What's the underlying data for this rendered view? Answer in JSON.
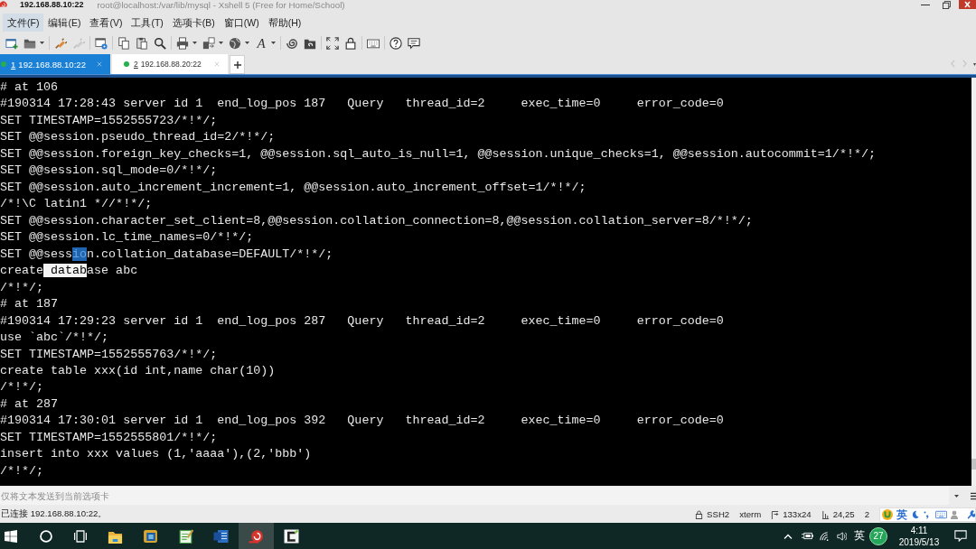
{
  "window": {
    "host": "192.168.88.10:22",
    "title": "root@localhost:/var/lib/mysql - Xshell 5 (Free for Home/School)"
  },
  "menu": [
    {
      "label": "文件(F)",
      "selected": true
    },
    {
      "label": "编辑(E)",
      "selected": false
    },
    {
      "label": "查看(V)",
      "selected": false
    },
    {
      "label": "工具(T)",
      "selected": false
    },
    {
      "label": "选项卡(B)",
      "selected": false
    },
    {
      "label": "窗口(W)",
      "selected": false
    },
    {
      "label": "帮助(H)",
      "selected": false
    }
  ],
  "toolbar": {
    "groups": [
      {
        "buttons": [
          {
            "kind": "new",
            "disabled": false,
            "dropdown": false
          },
          {
            "kind": "open",
            "disabled": false,
            "dropdown": true
          }
        ]
      },
      {
        "buttons": [
          {
            "kind": "plug",
            "disabled": false,
            "dropdown": false
          },
          {
            "kind": "plug",
            "disabled": true,
            "dropdown": false
          }
        ]
      },
      {
        "buttons": [
          {
            "kind": "properties",
            "disabled": false,
            "dropdown": false
          }
        ]
      },
      {
        "buttons": [
          {
            "kind": "copy",
            "disabled": false,
            "dropdown": false
          },
          {
            "kind": "paste",
            "disabled": false,
            "dropdown": false
          },
          {
            "kind": "find",
            "disabled": false,
            "dropdown": false
          }
        ]
      },
      {
        "buttons": [
          {
            "kind": "print",
            "disabled": false,
            "dropdown": true
          },
          {
            "kind": "transfer",
            "disabled": false,
            "dropdown": true
          },
          {
            "kind": "globe",
            "disabled": false,
            "dropdown": true
          },
          {
            "kind": "font",
            "glyph": "A",
            "disabled": false,
            "dropdown": true
          }
        ]
      },
      {
        "buttons": [
          {
            "kind": "spiral",
            "disabled": false,
            "dropdown": false
          },
          {
            "kind": "spiral-folder",
            "disabled": false,
            "dropdown": false
          }
        ]
      },
      {
        "buttons": [
          {
            "kind": "fullscreen",
            "disabled": false,
            "dropdown": false
          },
          {
            "kind": "lock",
            "disabled": false,
            "dropdown": false
          }
        ]
      },
      {
        "buttons": [
          {
            "kind": "keyboard",
            "disabled": false,
            "dropdown": false
          }
        ]
      },
      {
        "buttons": [
          {
            "kind": "help",
            "disabled": false,
            "dropdown": false
          },
          {
            "kind": "chat",
            "disabled": false,
            "dropdown": false
          }
        ]
      }
    ]
  },
  "tabs": [
    {
      "number": "1",
      "label": "192.168.88.10:22",
      "selected": true,
      "connected": true
    },
    {
      "number": "2",
      "label": "192.168.88.20:22",
      "selected": false,
      "connected": true
    }
  ],
  "terminal": {
    "lines": [
      {
        "text": "# at 106"
      },
      {
        "text": "#190314 17:28:43 server id 1  end_log_pos 187   Query   thread_id=2     exec_time=0     error_code=0"
      },
      {
        "text": "SET TIMESTAMP=1552555723/*!*/;"
      },
      {
        "text": "SET @@session.pseudo_thread_id=2/*!*/;"
      },
      {
        "text": "SET @@session.foreign_key_checks=1, @@session.sql_auto_is_null=1, @@session.unique_checks=1, @@session.autocommit=1/*!*/;"
      },
      {
        "text": "SET @@session.sql_mode=0/*!*/;"
      },
      {
        "text": "SET @@session.auto_increment_increment=1, @@session.auto_increment_offset=1/*!*/;"
      },
      {
        "text": "/*!\\C latin1 *//*!*/;"
      },
      {
        "text": "SET @@session.character_set_client=8,@@session.collation_connection=8,@@session.collation_server=8/*!*/;"
      },
      {
        "text": "SET @@session.lc_time_names=0/*!*/;"
      },
      {
        "parts": [
          {
            "text": "SET @@sess",
            "kind": "plain"
          },
          {
            "text": "io",
            "kind": "highlight"
          },
          {
            "text": "n.collation_database=DEFAULT/*!*/;",
            "kind": "plain"
          }
        ]
      },
      {
        "parts": [
          {
            "text": "create",
            "kind": "plain"
          },
          {
            "text": " datab",
            "kind": "selection"
          },
          {
            "text": "ase abc",
            "kind": "plain"
          }
        ]
      },
      {
        "text": "/*!*/;"
      },
      {
        "text": "# at 187"
      },
      {
        "text": "#190314 17:29:23 server id 1  end_log_pos 287   Query   thread_id=2     exec_time=0     error_code=0"
      },
      {
        "text": "use `abc`/*!*/;"
      },
      {
        "text": "SET TIMESTAMP=1552555763/*!*/;"
      },
      {
        "text": "create table xxx(id int,name char(10))"
      },
      {
        "text": "/*!*/;"
      },
      {
        "text": "# at 287"
      },
      {
        "text": "#190314 17:30:01 server id 1  end_log_pos 392   Query   thread_id=2     exec_time=0     error_code=0"
      },
      {
        "text": "SET TIMESTAMP=1552555801/*!*/;"
      },
      {
        "text": "insert into xxx values (1,'aaaa'),(2,'bbb')"
      },
      {
        "text": "/*!*/;"
      }
    ]
  },
  "compose": {
    "placeholder": "仅将文本发送到当前选项卡"
  },
  "status_bar": {
    "message": "已连接 192.168.88.10:22。",
    "items": [
      {
        "kind": "lock",
        "text": "SSH2"
      },
      {
        "kind": "plain",
        "text": "xterm"
      },
      {
        "kind": "size",
        "text": "133x24"
      },
      {
        "kind": "cursor",
        "text": "24,25"
      },
      {
        "kind": "plain",
        "text": "2"
      }
    ]
  },
  "ime_bar": {
    "language": "英"
  },
  "taskbar": {
    "buttons": [
      {
        "kind": "start"
      },
      {
        "kind": "search"
      },
      {
        "kind": "task-view"
      }
    ],
    "apps": [
      {
        "kind": "folder",
        "selected": false
      },
      {
        "kind": "squares",
        "selected": false
      },
      {
        "kind": "notepad",
        "selected": false
      },
      {
        "kind": "document",
        "selected": false
      },
      {
        "kind": "shell",
        "selected": true
      },
      {
        "kind": "bracket",
        "selected": false
      }
    ],
    "tray": {
      "language": "英",
      "badge": "27",
      "time": "4:11",
      "date": "2019/5/13"
    }
  }
}
